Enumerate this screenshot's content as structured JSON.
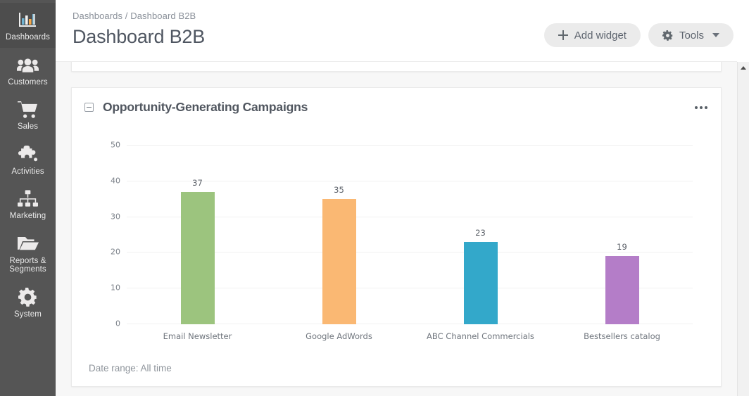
{
  "sidebar": {
    "items": [
      {
        "label": "Dashboards",
        "icon": "bar-chart-icon",
        "active": true
      },
      {
        "label": "Customers",
        "icon": "users-icon",
        "active": false
      },
      {
        "label": "Sales",
        "icon": "shopping-cart-icon",
        "active": false
      },
      {
        "label": "Activities",
        "icon": "puzzle-piece-icon",
        "active": false
      },
      {
        "label": "Marketing",
        "icon": "sitemap-icon",
        "active": false
      },
      {
        "label": "Reports &\nSegments",
        "icon": "folder-icon",
        "active": false
      },
      {
        "label": "System",
        "icon": "gear-icon",
        "active": false
      }
    ]
  },
  "header": {
    "breadcrumb": "Dashboards / Dashboard B2B",
    "title": "Dashboard B2B",
    "add_widget_label": "Add widget",
    "add_widget_icon": "plus-icon",
    "tools_label": "Tools",
    "tools_icon": "gear-icon",
    "tools_caret_icon": "chevron-down-icon"
  },
  "widget": {
    "title": "Opportunity-Generating Campaigns",
    "collapse_icon": "collapse-minus-icon",
    "menu_icon": "ellipsis-icon",
    "date_range": "Date range: All time"
  },
  "chart_data": {
    "type": "bar",
    "title": "Opportunity-Generating Campaigns",
    "categories": [
      "Email Newsletter",
      "Google AdWords",
      "ABC Channel Commercials",
      "Bestsellers catalog"
    ],
    "values": [
      37,
      35,
      23,
      19
    ],
    "colors": [
      "#9cc47e",
      "#fab873",
      "#33a8ca",
      "#b47dc8"
    ],
    "xlabel": "",
    "ylabel": "",
    "ylim": [
      0,
      50
    ],
    "yticks": [
      0,
      10,
      20,
      30,
      40,
      50
    ],
    "grid": true,
    "legend": "none",
    "data_labels": true
  },
  "scrollbar": {
    "up_arrow_icon": "triangle-up-icon"
  }
}
